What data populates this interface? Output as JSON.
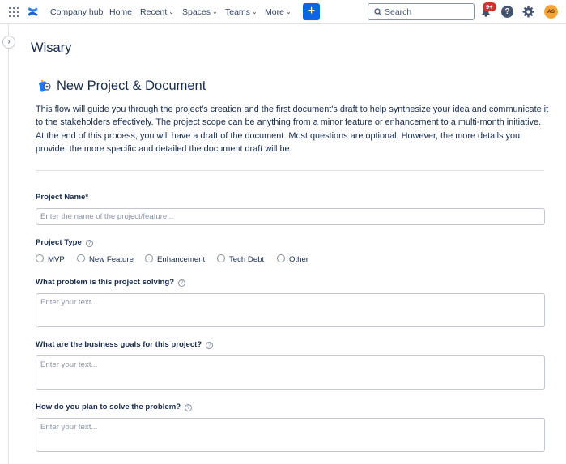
{
  "topnav": {
    "app_name": "Company hub",
    "links": [
      {
        "label": "Home",
        "has_menu": false
      },
      {
        "label": "Recent",
        "has_menu": true
      },
      {
        "label": "Spaces",
        "has_menu": true
      },
      {
        "label": "Teams",
        "has_menu": true
      },
      {
        "label": "More",
        "has_menu": true
      }
    ],
    "create_label": "+",
    "search_placeholder": "Search",
    "notification_count": "9+",
    "help_label": "?",
    "avatar_initials": "AS",
    "accent_color": "#0c66e4"
  },
  "page": {
    "title": "Wisary"
  },
  "form": {
    "heading": "New Project & Document",
    "intro": "This flow will guide you through the project's creation and the first document's draft to help synthesize your idea and communicate it to the stakeholders effectively. The project scope can be anything from a minor feature or enhancement to a multi-month initiative. At the end of this process, you will have a draft of the document. Most questions are optional. However, the more details you provide, the more specific and detailed the document draft will be.",
    "project_name": {
      "label": "Project Name*",
      "value": "",
      "placeholder": "Enter the name of the project/feature..."
    },
    "project_type": {
      "label": "Project Type",
      "options": [
        "MVP",
        "New Feature",
        "Enhancement",
        "Tech Debt",
        "Other"
      ]
    },
    "problem": {
      "label": "What problem is this project solving?",
      "value": "",
      "placeholder": "Enter your text..."
    },
    "goals": {
      "label": "What are the business goals for this project?",
      "value": "",
      "placeholder": "Enter your text..."
    },
    "solution": {
      "label": "How do you plan to solve the problem?",
      "value": "",
      "placeholder": "Enter your text..."
    }
  }
}
